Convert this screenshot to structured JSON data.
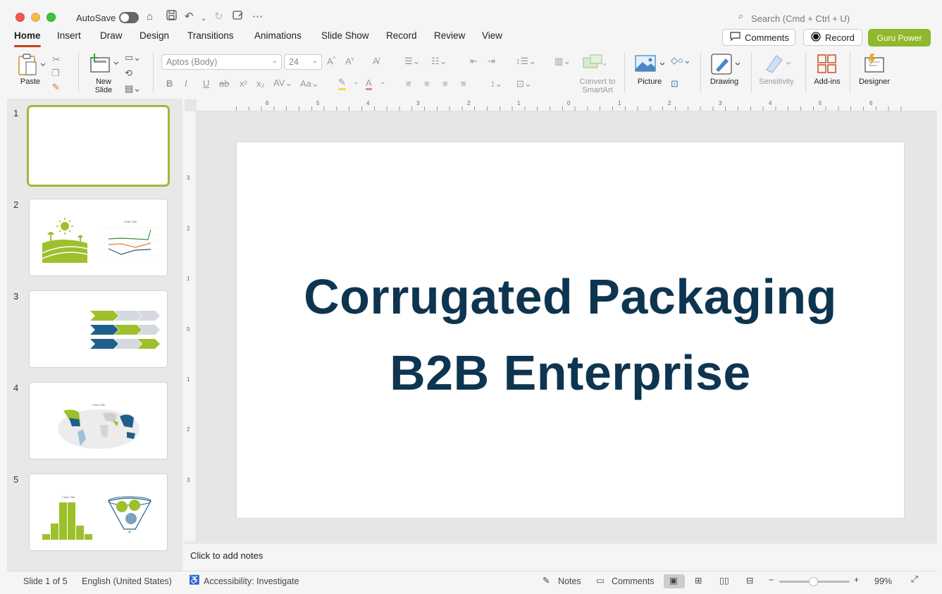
{
  "titlebar": {
    "autosave_label": "AutoSave",
    "search_placeholder": "Search (Cmd + Ctrl + U)"
  },
  "tabs": [
    "Home",
    "Insert",
    "Draw",
    "Design",
    "Transitions",
    "Animations",
    "Slide Show",
    "Record",
    "Review",
    "View"
  ],
  "actions": {
    "comments": "Comments",
    "record": "Record",
    "addin": "Guru Power"
  },
  "ribbon": {
    "paste": "Paste",
    "new_slide": "New\nSlide",
    "font_name": "Aptos (Body)",
    "font_size": "24",
    "convert_smartart": "Convert to\nSmartArt",
    "picture": "Picture",
    "drawing": "Drawing",
    "sensitivity": "Sensitivity",
    "addins": "Add-ins",
    "designer": "Designer"
  },
  "slides": [
    {
      "number": "1"
    },
    {
      "number": "2",
      "thumb_chart_title": "Chart Title"
    },
    {
      "number": "3"
    },
    {
      "number": "4",
      "thumb_chart_title": "Chart Title"
    },
    {
      "number": "5",
      "thumb_chart_title": "Chart Title"
    }
  ],
  "slide": {
    "title_line1": "Corrugated Packaging",
    "title_line2": "B2B Enterprise"
  },
  "notes_placeholder": "Click to add notes",
  "rulers": {
    "h_ticks": [
      "6",
      "5",
      "4",
      "3",
      "2",
      "1",
      "0",
      "1",
      "2",
      "3",
      "4",
      "5",
      "6"
    ],
    "v_ticks": [
      "3",
      "2",
      "1",
      "0",
      "1",
      "2",
      "3"
    ]
  },
  "status": {
    "slide_of": "Slide 1 of 5",
    "language": "English (United States)",
    "accessibility": "Accessibility: Investigate",
    "notes": "Notes",
    "comments": "Comments",
    "zoom": "99%"
  },
  "colors": {
    "accent": "#c43e1c",
    "brand_green": "#8fb82a",
    "title_color": "#0e3550"
  }
}
